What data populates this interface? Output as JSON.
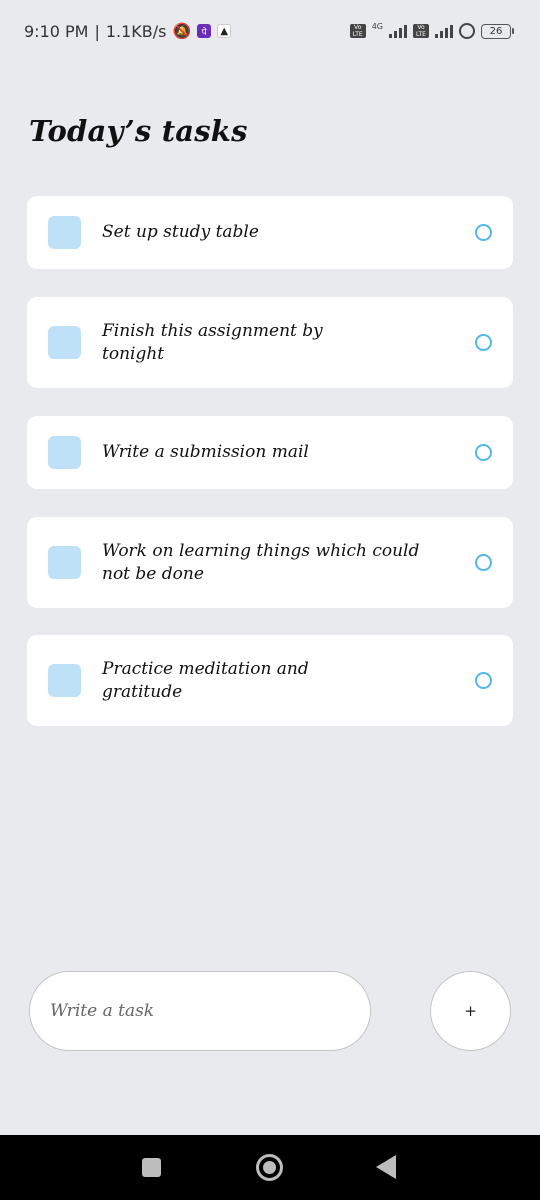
{
  "status_bar": {
    "time": "9:10 PM",
    "separator": "|",
    "speed": "1.1KB/s",
    "network_type": "4G",
    "volte_label": "Vo\nLTE",
    "battery": "26",
    "icons": [
      "mute-bell-icon",
      "phonepe-icon",
      "notification-icon",
      "volte-icon",
      "signal-icon",
      "sync-icon",
      "battery-icon"
    ]
  },
  "header": {
    "title": "Today’s tasks"
  },
  "tasks": [
    {
      "text": "Set up study table"
    },
    {
      "text": "Finish this assignment by tonight"
    },
    {
      "text": "Write a submission mail"
    },
    {
      "text": "Work on learning things which could not be done"
    },
    {
      "text": "Practice meditation and gratitude"
    }
  ],
  "composer": {
    "placeholder": "Write a task",
    "add_label": "+"
  },
  "colors": {
    "background": "#e8eaed",
    "card": "#ffffff",
    "checkbox": "#bfe1f7",
    "status_ring": "#55b7e8"
  }
}
